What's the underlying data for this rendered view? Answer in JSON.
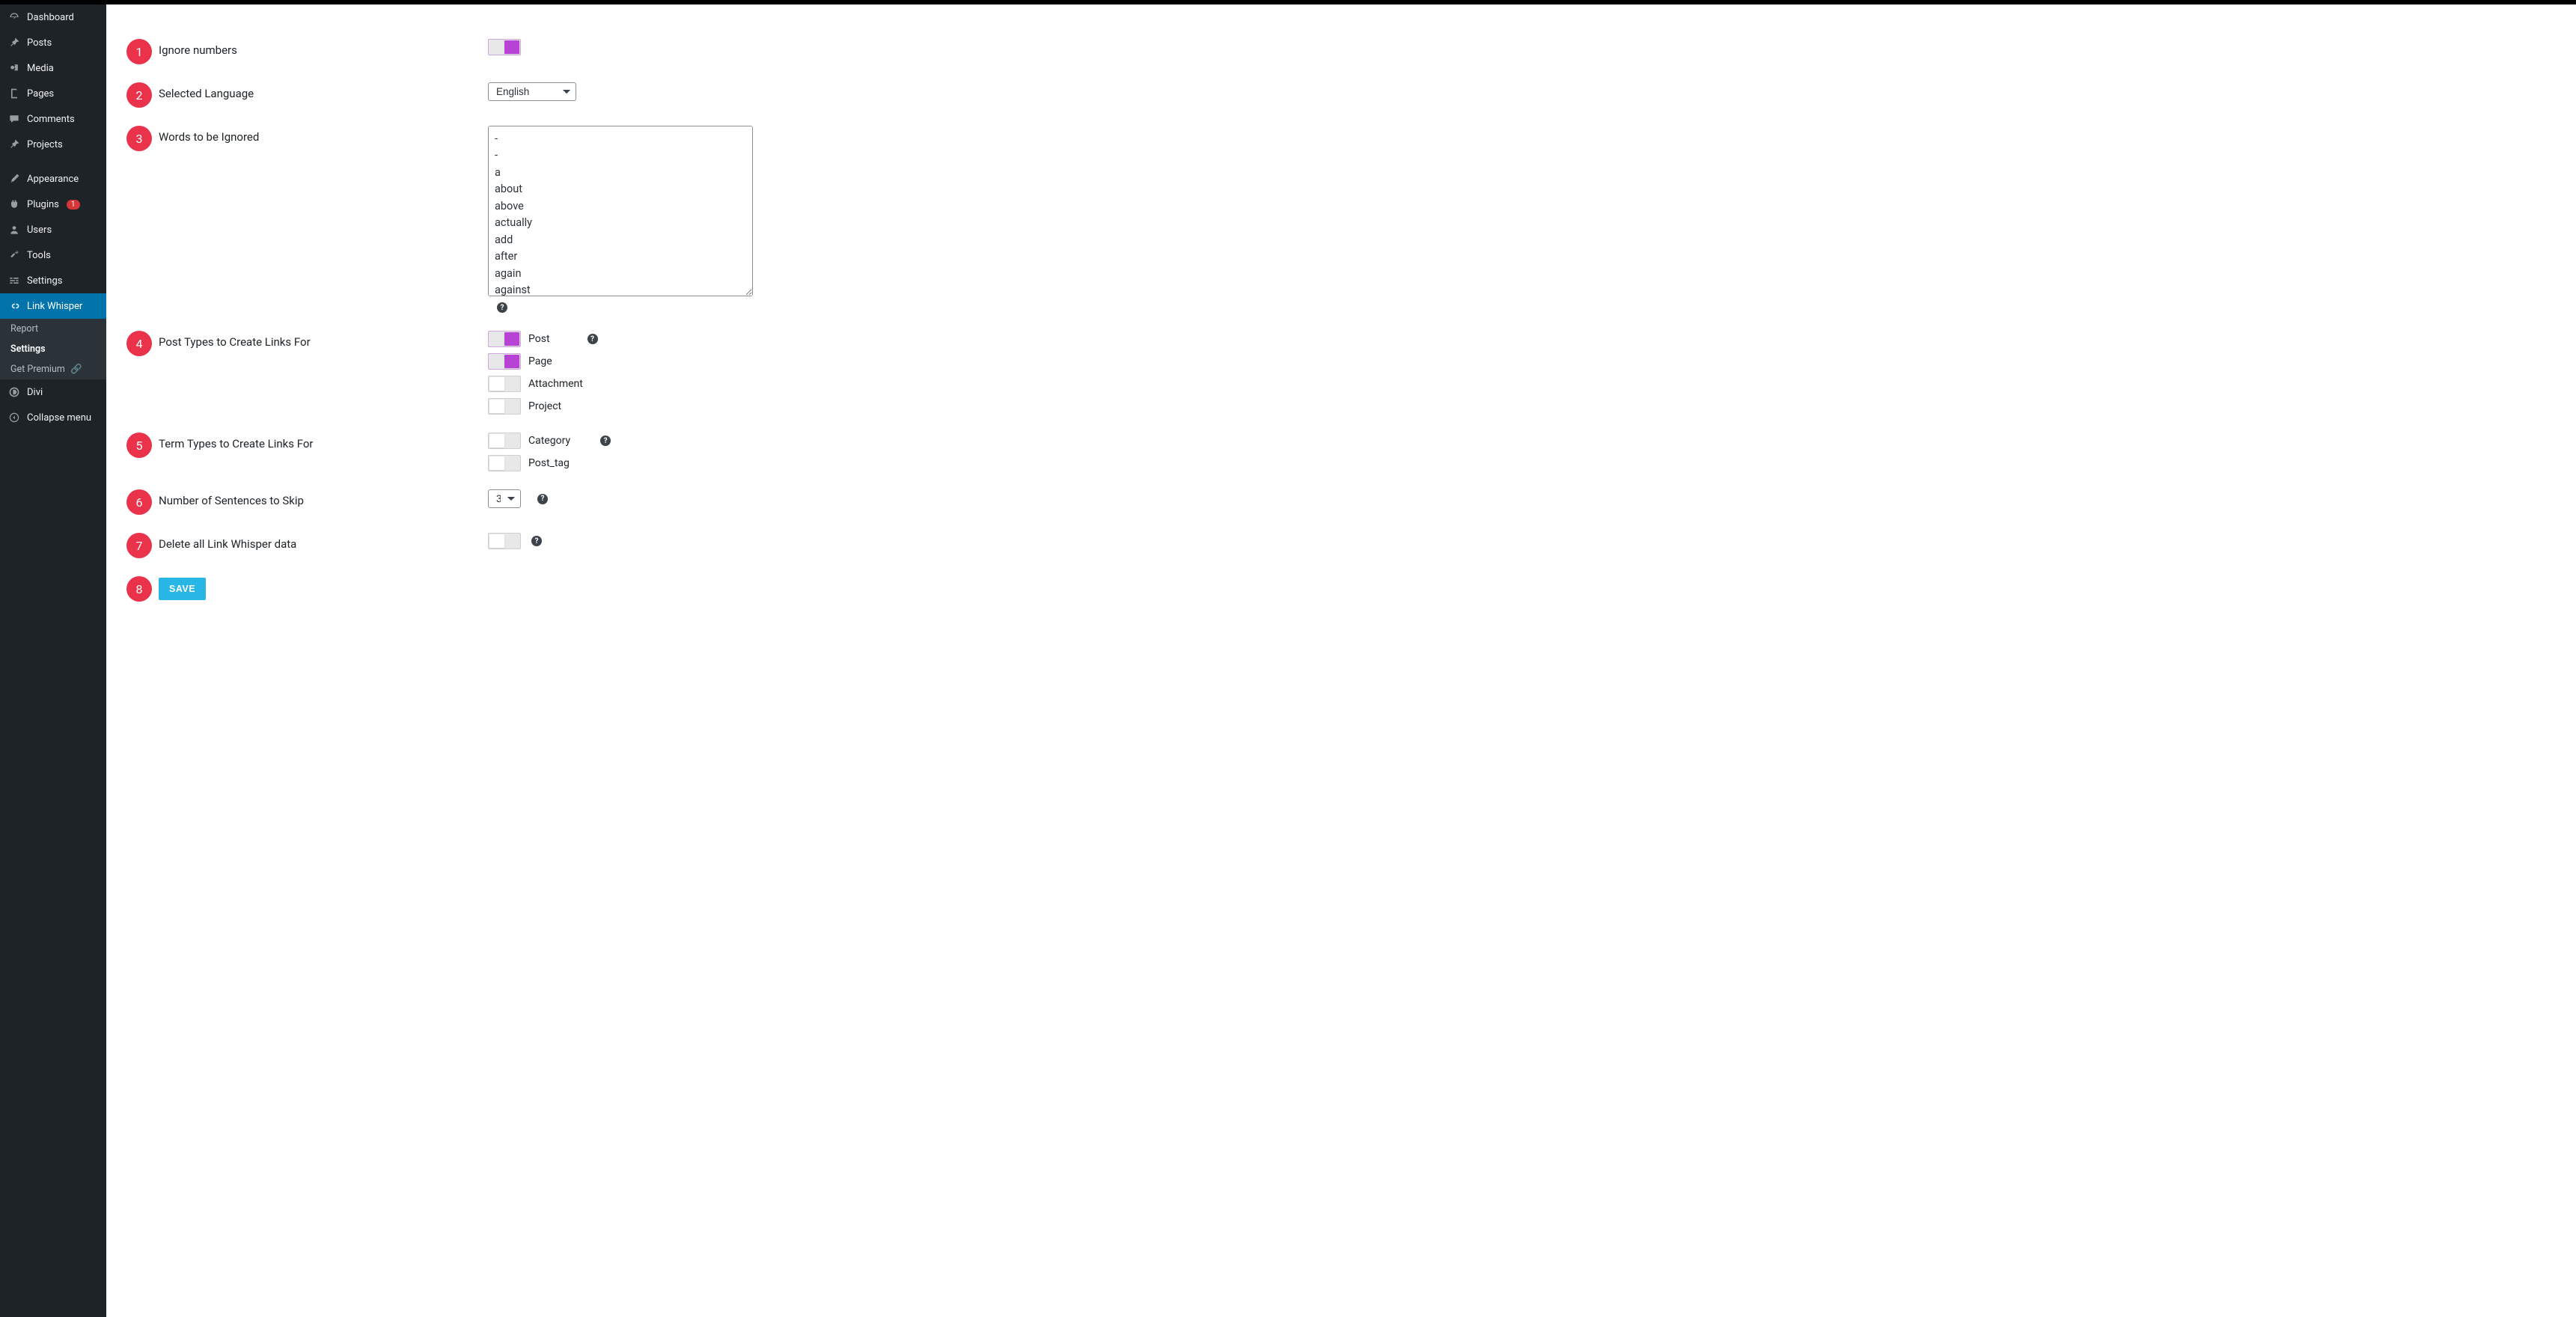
{
  "sidebar": {
    "items": [
      {
        "label": "Dashboard"
      },
      {
        "label": "Posts"
      },
      {
        "label": "Media"
      },
      {
        "label": "Pages"
      },
      {
        "label": "Comments"
      },
      {
        "label": "Projects"
      },
      {
        "label": "Appearance"
      },
      {
        "label": "Plugins",
        "badge": "1"
      },
      {
        "label": "Users"
      },
      {
        "label": "Tools"
      },
      {
        "label": "Settings"
      },
      {
        "label": "Link Whisper"
      },
      {
        "label": "Divi"
      },
      {
        "label": "Collapse menu"
      }
    ],
    "sub": {
      "report": "Report",
      "settings": "Settings",
      "premium": "Get Premium"
    }
  },
  "settings": {
    "rows": [
      {
        "num": "1",
        "label": "Ignore numbers"
      },
      {
        "num": "2",
        "label": "Selected Language",
        "select_value": "English"
      },
      {
        "num": "3",
        "label": "Words to be Ignored",
        "textarea_value": "-\n-\na\nabout\nabove\nactually\nadd\nafter\nagain\nagainst"
      },
      {
        "num": "4",
        "label": "Post Types to Create Links For"
      },
      {
        "num": "5",
        "label": "Term Types to Create Links For"
      },
      {
        "num": "6",
        "label": "Number of Sentences to Skip",
        "select_value": "3"
      },
      {
        "num": "7",
        "label": "Delete all Link Whisper data"
      },
      {
        "num": "8",
        "label": ""
      }
    ],
    "post_types": [
      {
        "label": "Post",
        "on": true
      },
      {
        "label": "Page",
        "on": true
      },
      {
        "label": "Attachment",
        "on": false
      },
      {
        "label": "Project",
        "on": false
      }
    ],
    "term_types": [
      {
        "label": "Category",
        "on": false
      },
      {
        "label": "Post_tag",
        "on": false
      }
    ],
    "save_label": "SAVE",
    "help": "?"
  }
}
